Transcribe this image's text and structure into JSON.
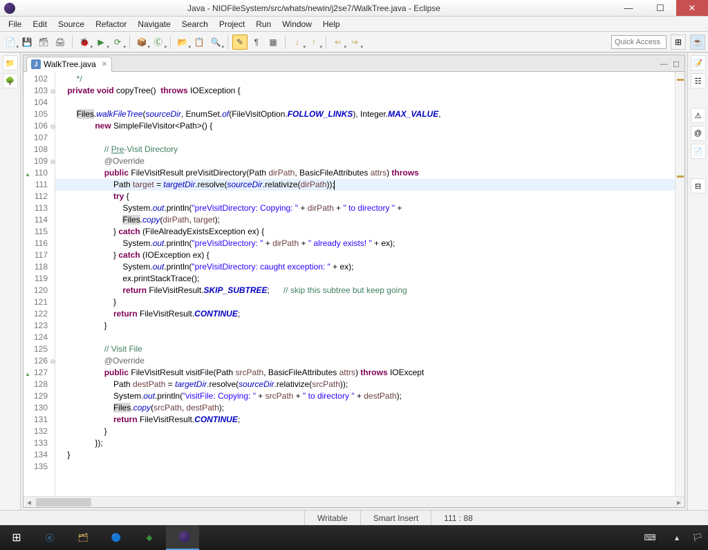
{
  "window": {
    "title": "Java - NIOFileSystem/src/whats/newin/j2se7/WalkTree.java - Eclipse"
  },
  "menu": [
    "File",
    "Edit",
    "Source",
    "Refactor",
    "Navigate",
    "Search",
    "Project",
    "Run",
    "Window",
    "Help"
  ],
  "quick_access": {
    "placeholder": "Quick Access"
  },
  "editor": {
    "tab_name": "WalkTree.java",
    "first_line": 102
  },
  "status": {
    "writable": "Writable",
    "insert": "Smart Insert",
    "pos": "111 : 88"
  },
  "code_lines": [
    {
      "n": 102,
      "html": "        */",
      "cls": "com"
    },
    {
      "n": 103,
      "fold": true,
      "html": "    <span class='kw'>private</span> <span class='kw'>void</span> copyTree()  <span class='kw'>throws</span> IOException {"
    },
    {
      "n": 104,
      "html": " "
    },
    {
      "n": 105,
      "html": "        <span class='hi'>Files</span>.<span class='fld'>walkFileTree</span>(<span class='fld'>sourceDir</span>, EnumSet.<span class='fld'>of</span>(FileVisitOption.<span class='cst'>FOLLOW_LINKS</span>), Integer.<span class='cst'>MAX_VALUE</span>,"
    },
    {
      "n": 106,
      "fold": true,
      "html": "                <span class='kw'>new</span> SimpleFileVisitor&lt;Path&gt;() {"
    },
    {
      "n": 107,
      "html": " "
    },
    {
      "n": 108,
      "html": "                    <span class='com'>// <u>Pre</u>-Visit Directory</span>"
    },
    {
      "n": 109,
      "fold": true,
      "html": "                    <span class='ann'>@Override</span>"
    },
    {
      "n": 110,
      "warn": true,
      "html": "                    <span class='kw'>public</span> FileVisitResult preVisitDirectory(Path <span class='prm'>dirPath</span>, BasicFileAttributes <span class='prm'>attrs</span>) <span class='kw'>throws</span>"
    },
    {
      "n": 111,
      "hl": true,
      "html": "                        Path <span class='prm'>target</span> = <span class='fld'>targetDir</span>.resolve(<span class='fld'>sourceDir</span>.relativize(<span class='prm'>dirPath</span>));<span class='cursor-bar'></span>"
    },
    {
      "n": 112,
      "html": "                        <span class='kw'>try</span> {"
    },
    {
      "n": 113,
      "html": "                            System.<span class='fld'>out</span>.println(<span class='str'>\"preVisitDirectory: Copying: \"</span> + <span class='prm'>dirPath</span> + <span class='str'>\" to directory \"</span> +"
    },
    {
      "n": 114,
      "html": "                            <span class='hi'>Files</span>.<span class='fld'>copy</span>(<span class='prm'>dirPath</span>, <span class='prm'>target</span>);"
    },
    {
      "n": 115,
      "html": "                        } <span class='kw'>catch</span> (FileAlreadyExistsException ex) {"
    },
    {
      "n": 116,
      "html": "                            System.<span class='fld'>out</span>.println(<span class='str'>\"preVisitDirectory: \"</span> + <span class='prm'>dirPath</span> + <span class='str'>\" already exists! \"</span> + ex);"
    },
    {
      "n": 117,
      "html": "                        } <span class='kw'>catch</span> (IOException ex) {"
    },
    {
      "n": 118,
      "html": "                            System.<span class='fld'>out</span>.println(<span class='str'>\"preVisitDirectory: caught exception: \"</span> + ex);"
    },
    {
      "n": 119,
      "html": "                            ex.printStackTrace();"
    },
    {
      "n": 120,
      "html": "                            <span class='kw'>return</span> FileVisitResult.<span class='cst'>SKIP_SUBTREE</span>;      <span class='com'>// skip this subtree but keep going</span>"
    },
    {
      "n": 121,
      "html": "                        }"
    },
    {
      "n": 122,
      "html": "                        <span class='kw'>return</span> FileVisitResult.<span class='cst'>CONTINUE</span>;"
    },
    {
      "n": 123,
      "html": "                    }"
    },
    {
      "n": 124,
      "html": " "
    },
    {
      "n": 125,
      "html": "                    <span class='com'>// Visit File</span>"
    },
    {
      "n": 126,
      "fold": true,
      "html": "                    <span class='ann'>@Override</span>"
    },
    {
      "n": 127,
      "warn": true,
      "html": "                    <span class='kw'>public</span> FileVisitResult visitFile(Path <span class='prm'>srcPath</span>, BasicFileAttributes <span class='prm'>attrs</span>) <span class='kw'>throws</span> IOExcept"
    },
    {
      "n": 128,
      "html": "                        Path <span class='prm'>destPath</span> = <span class='fld'>targetDir</span>.resolve(<span class='fld'>sourceDir</span>.relativize(<span class='prm'>srcPath</span>));"
    },
    {
      "n": 129,
      "html": "                        System.<span class='fld'>out</span>.println(<span class='str'>\"visitFile: Copying: \"</span> + <span class='prm'>srcPath</span> + <span class='str'>\" to directory \"</span> + <span class='prm'>destPath</span>);"
    },
    {
      "n": 130,
      "html": "                        <span class='hi'>Files</span>.<span class='fld'>copy</span>(<span class='prm'>srcPath</span>, <span class='prm'>destPath</span>);"
    },
    {
      "n": 131,
      "html": "                        <span class='kw'>return</span> FileVisitResult.<span class='cst'>CONTINUE</span>;"
    },
    {
      "n": 132,
      "html": "                    }"
    },
    {
      "n": 133,
      "html": "                });"
    },
    {
      "n": 134,
      "html": "    }"
    },
    {
      "n": 135,
      "html": " "
    }
  ]
}
